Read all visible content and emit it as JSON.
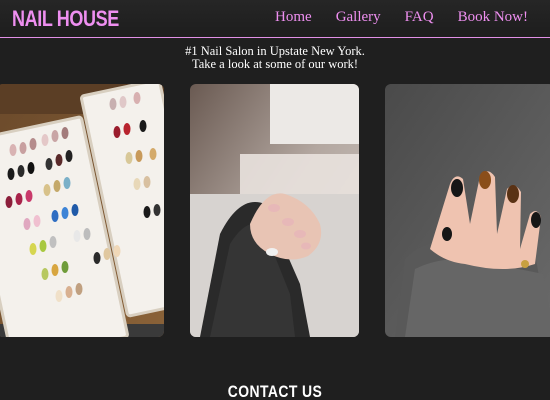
{
  "header": {
    "logo": "NAIL HOUSE",
    "nav": [
      "Home",
      "Gallery",
      "FAQ",
      "Book Now!"
    ]
  },
  "intro": {
    "line1": "#1 Nail Salon in Upstate New York.",
    "line2": "Take a look at some of our work!"
  },
  "gallery": {
    "items": [
      {
        "subject": "nail-tips-display-tray"
      },
      {
        "subject": "nude-manicure-hand"
      },
      {
        "subject": "dark-tortoiseshell-manicure-hand"
      }
    ]
  },
  "contact": {
    "heading": "CONTACT US"
  },
  "colors": {
    "accent": "#ee8ff0",
    "background": "#1f1f1f",
    "header_border": "#e18fe6"
  }
}
